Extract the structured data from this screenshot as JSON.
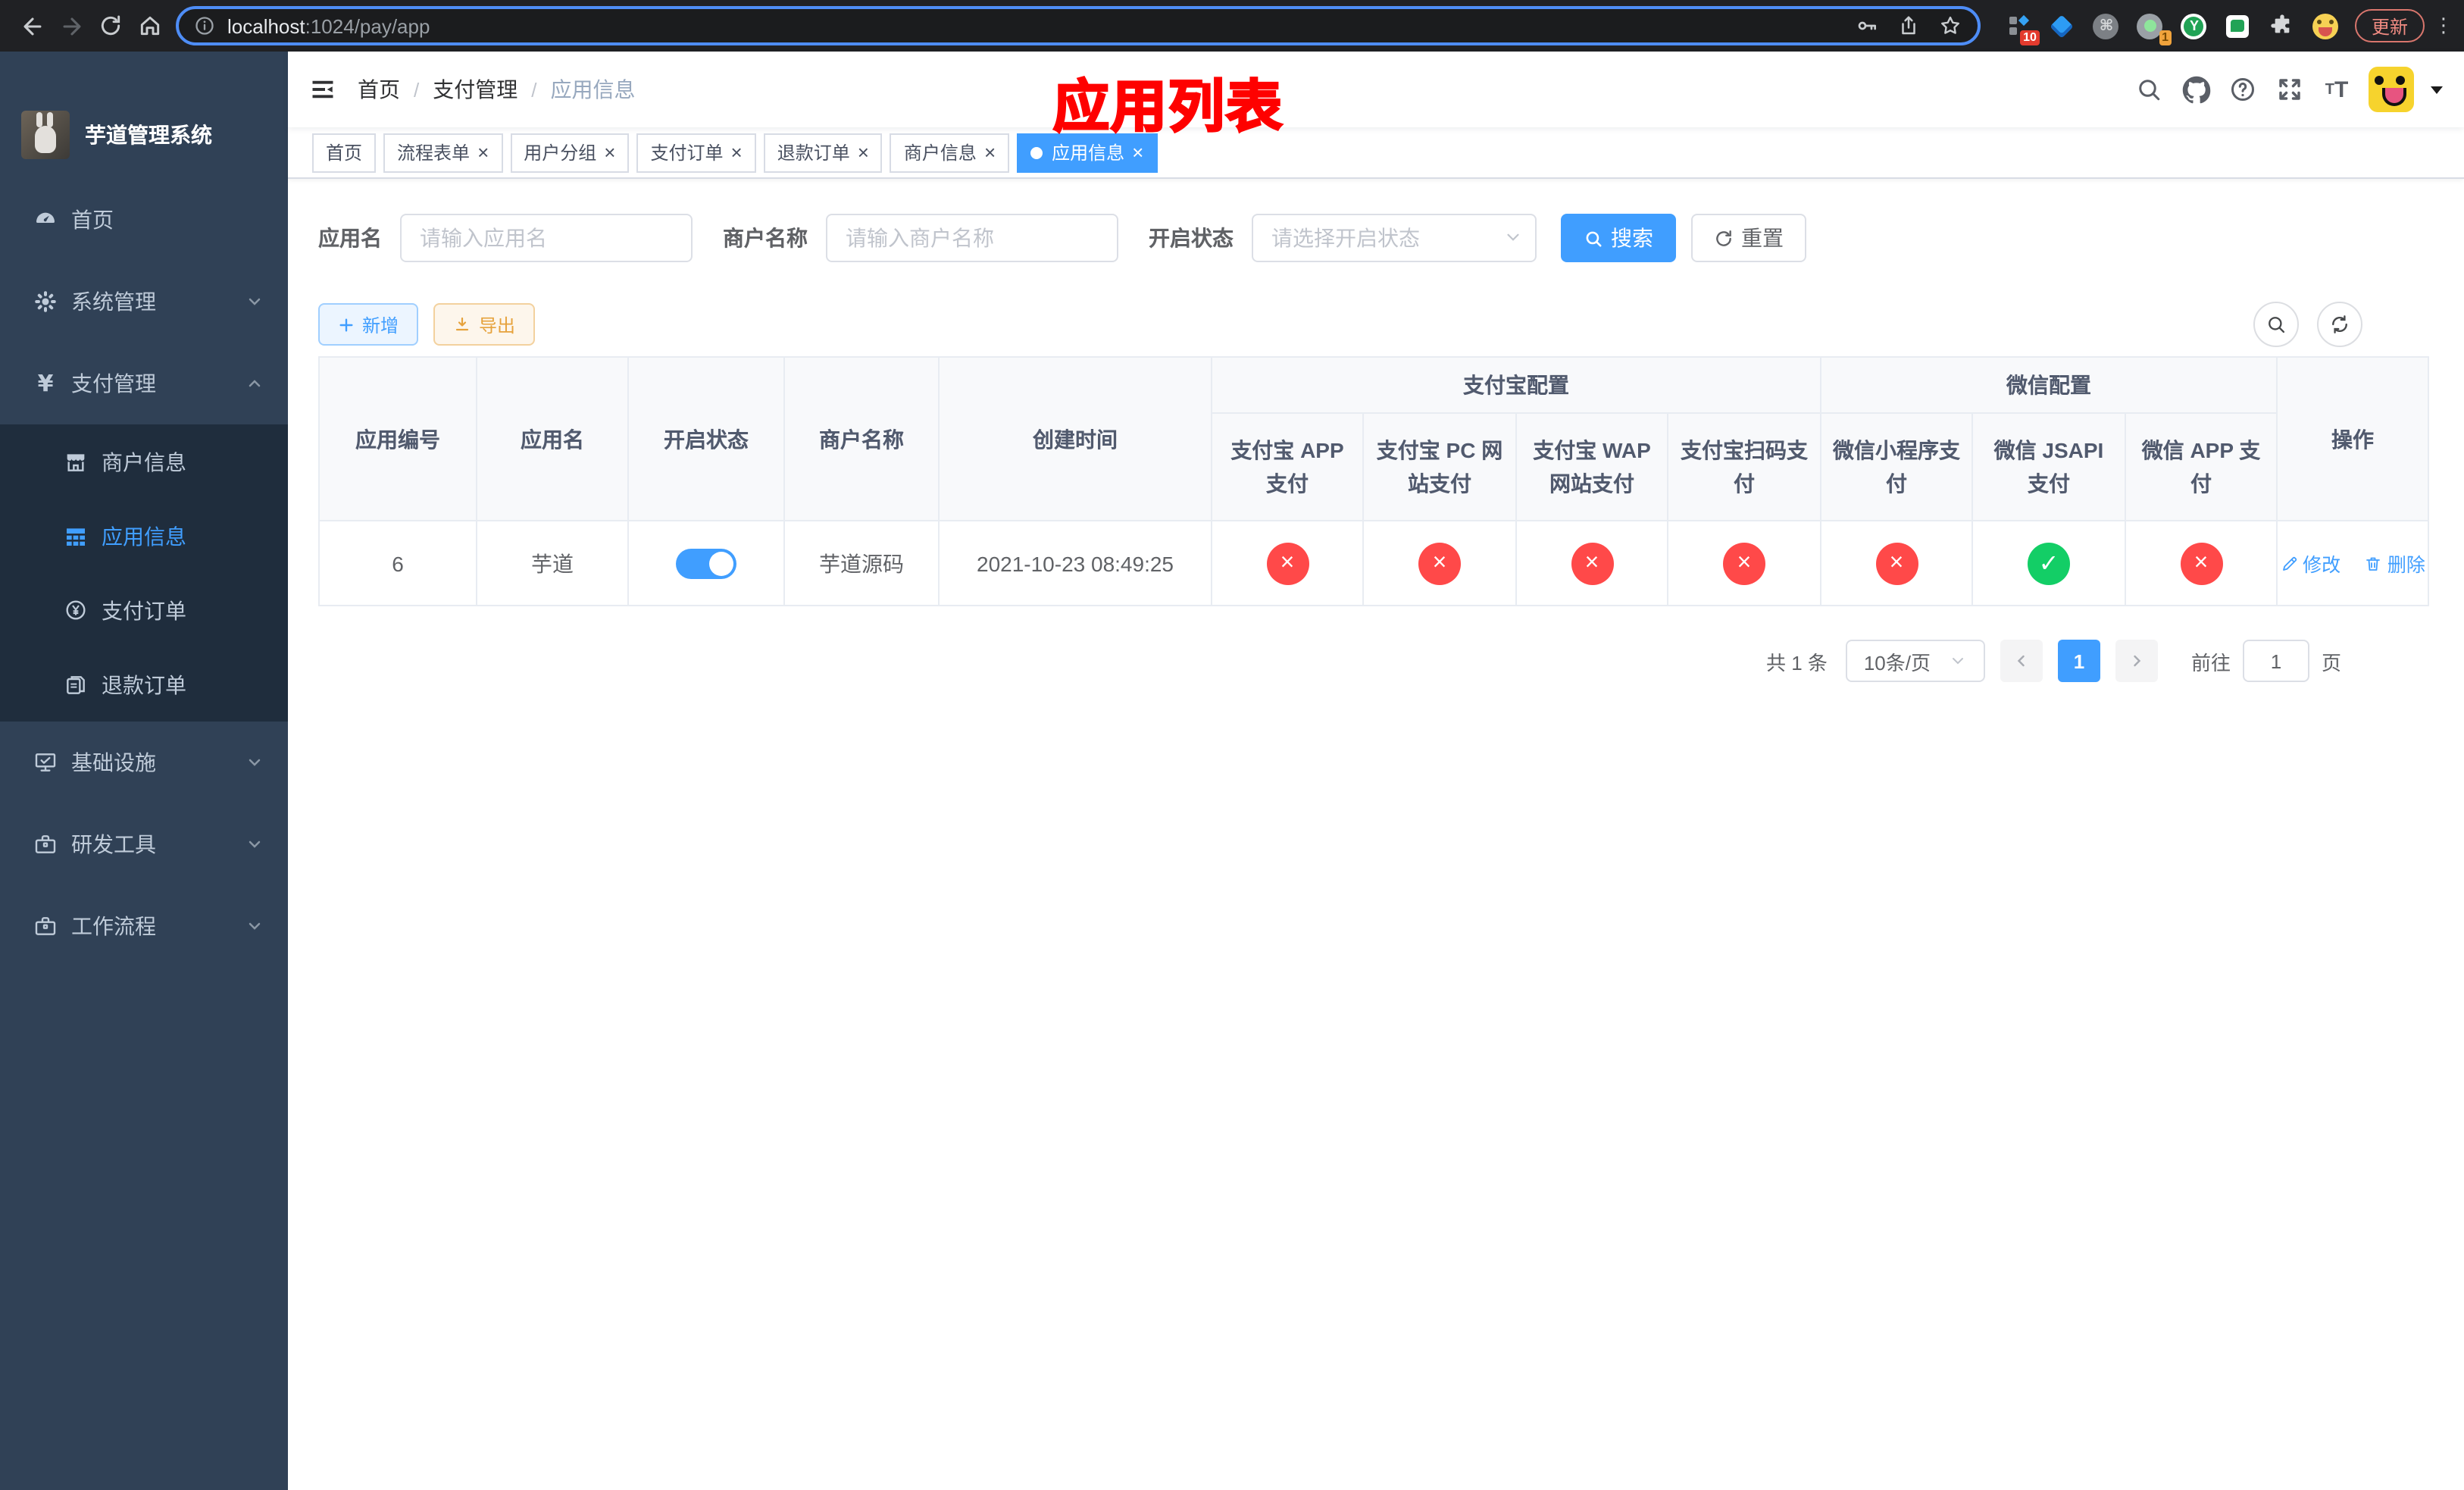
{
  "browser": {
    "url_host": "localhost",
    "url_rest": ":1024/pay/app",
    "update_label": "更新",
    "ext_badge_1": "10",
    "ext_badge_2": "1",
    "ext_y_label": "Y"
  },
  "sidebar": {
    "title": "芋道管理系统",
    "items": [
      {
        "label": "首页"
      },
      {
        "label": "系统管理"
      },
      {
        "label": "支付管理"
      },
      {
        "label": "商户信息"
      },
      {
        "label": "应用信息"
      },
      {
        "label": "支付订单"
      },
      {
        "label": "退款订单"
      },
      {
        "label": "基础设施"
      },
      {
        "label": "研发工具"
      },
      {
        "label": "工作流程"
      }
    ],
    "currency_symbol": "¥"
  },
  "navbar": {
    "breadcrumb": [
      "首页",
      "支付管理",
      "应用信息"
    ],
    "annotation": "应用列表"
  },
  "tabs": [
    {
      "label": "首页"
    },
    {
      "label": "流程表单"
    },
    {
      "label": "用户分组"
    },
    {
      "label": "支付订单"
    },
    {
      "label": "退款订单"
    },
    {
      "label": "商户信息"
    },
    {
      "label": "应用信息"
    }
  ],
  "filters": {
    "app_name_label": "应用名",
    "app_name_placeholder": "请输入应用名",
    "merchant_label": "商户名称",
    "merchant_placeholder": "请输入商户名称",
    "status_label": "开启状态",
    "status_placeholder": "请选择开启状态",
    "search_label": "搜索",
    "reset_label": "重置"
  },
  "toolbar": {
    "add_label": "新增",
    "export_label": "导出"
  },
  "table": {
    "group_alipay": "支付宝配置",
    "group_wechat": "微信配置",
    "columns": {
      "id": "应用编号",
      "name": "应用名",
      "status": "开启状态",
      "merchant": "商户名称",
      "created": "创建时间",
      "alipay_app": "支付宝 APP 支付",
      "alipay_pc": "支付宝 PC 网站支付",
      "alipay_wap": "支付宝 WAP 网站支付",
      "alipay_qr": "支付宝扫码支付",
      "wx_lite": "微信小程序支付",
      "wx_jsapi": "微信 JSAPI 支付",
      "wx_app": "微信 APP 支付",
      "actions": "操作"
    },
    "row": {
      "id": "6",
      "name": "芋道",
      "enabled": true,
      "merchant": "芋道源码",
      "created": "2021-10-23 08:49:25",
      "configs": [
        {
          "name": "alipay_app",
          "enabled": false,
          "glyph": "×"
        },
        {
          "name": "alipay_pc",
          "enabled": false,
          "glyph": "×"
        },
        {
          "name": "alipay_wap",
          "enabled": false,
          "glyph": "×"
        },
        {
          "name": "alipay_qr",
          "enabled": false,
          "glyph": "×"
        },
        {
          "name": "wx_lite",
          "enabled": false,
          "glyph": "×"
        },
        {
          "name": "wx_jsapi",
          "enabled": true,
          "glyph": "✓"
        },
        {
          "name": "wx_app",
          "enabled": false,
          "glyph": "×"
        }
      ],
      "edit_label": "修改",
      "delete_label": "删除"
    }
  },
  "pagination": {
    "total_text": "共 1 条",
    "page_size": "10条/页",
    "current_page": "1",
    "goto_label": "前往",
    "goto_value": "1",
    "page_unit": "页"
  }
}
